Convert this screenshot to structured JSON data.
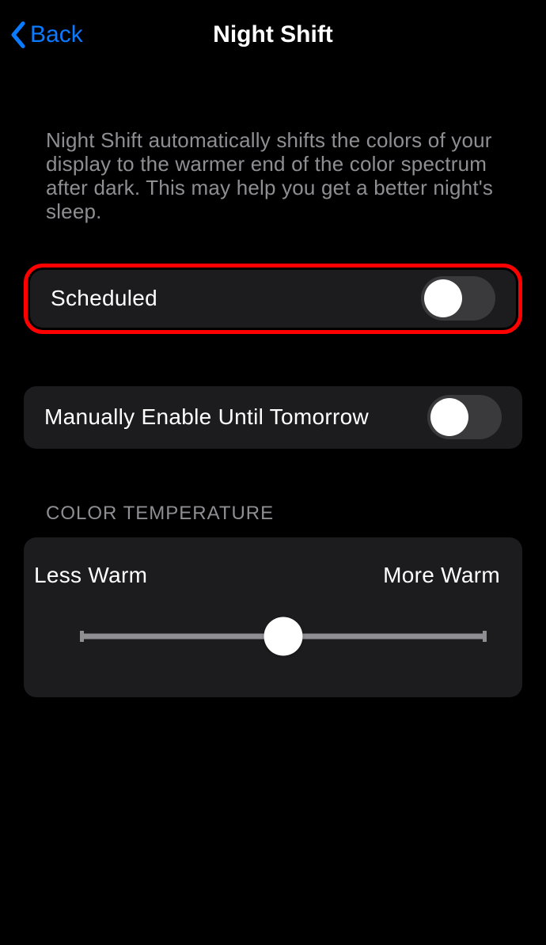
{
  "header": {
    "back_label": "Back",
    "title": "Night Shift"
  },
  "description": "Night Shift automatically shifts the colors of your display to the warmer end of the color spectrum after dark. This may help you get a better night's sleep.",
  "rows": {
    "scheduled": {
      "label": "Scheduled",
      "on": false
    },
    "manual": {
      "label": "Manually Enable Until Tomorrow",
      "on": false
    }
  },
  "temperature": {
    "header": "COLOR TEMPERATURE",
    "less_label": "Less Warm",
    "more_label": "More Warm",
    "value_percent": 50
  },
  "colors": {
    "accent": "#0a7aff",
    "highlight_border": "#ff0000",
    "panel_bg": "#1c1c1e",
    "secondary_text": "#8e8e93"
  }
}
